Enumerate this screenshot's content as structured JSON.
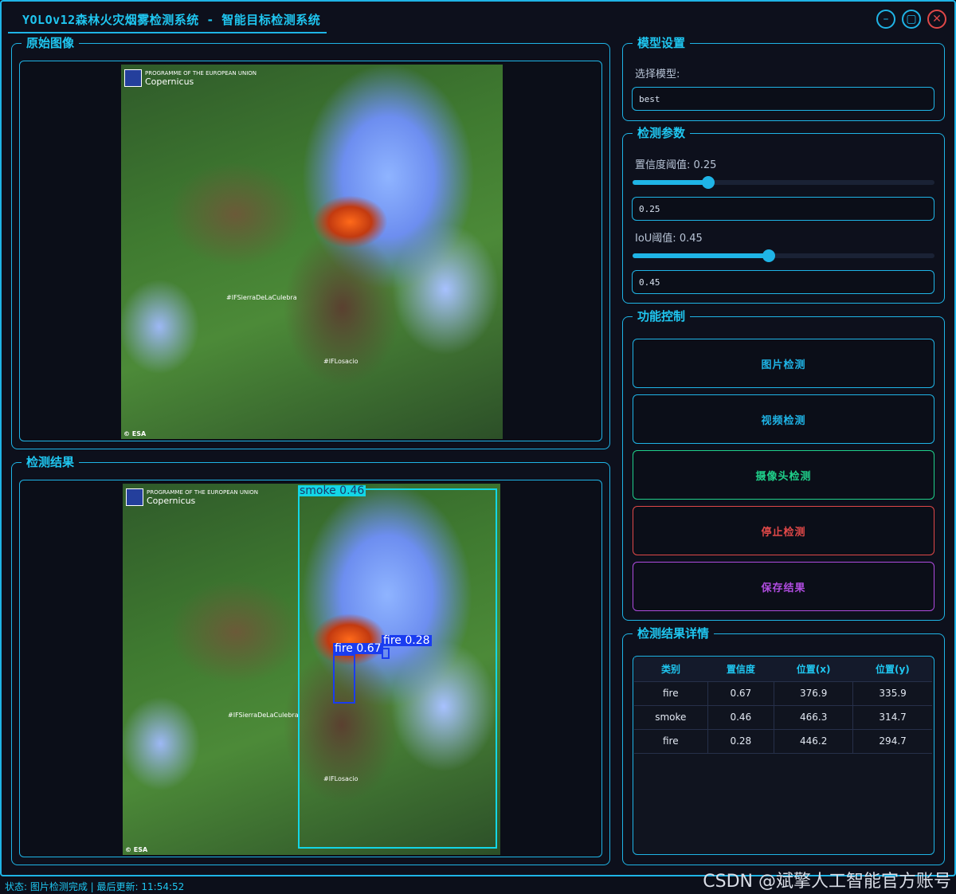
{
  "window": {
    "title": "YOLOv12森林火灾烟雾检测系统 - 智能目标检测系统",
    "min_icon": "minimize-icon",
    "max_icon": "maximize-icon",
    "close_icon": "close-icon"
  },
  "original_panel": {
    "title": "原始图像",
    "image": {
      "labels": [
        "#IFSierraDeLaCulebra",
        "#IFLosacio"
      ],
      "logo_text": "PROGRAMME OF THE EUROPEAN UNION",
      "brand": "Copernicus",
      "credit": "© ESA"
    }
  },
  "result_panel": {
    "title": "检测结果",
    "image": {
      "labels": [
        "#IFSierraDeLaCulebra",
        "#IFLosacio"
      ],
      "logo_text": "PROGRAMME OF THE EUROPEAN UNION",
      "brand": "Copernicus",
      "credit": "© ESA"
    },
    "detections": [
      {
        "label": "smoke 0.46",
        "color": "#13d6e6"
      },
      {
        "label": "fire 0.67",
        "color": "#1a3cf0"
      },
      {
        "label": "fire 0.28",
        "color": "#1a3cf0"
      }
    ]
  },
  "model_settings": {
    "title": "模型设置",
    "select_label": "选择模型:",
    "model_value": "best"
  },
  "detection_params": {
    "title": "检测参数",
    "conf_label": "置信度阈值: 0.25",
    "conf_value": 0.25,
    "conf_input": "0.25",
    "iou_label": "IoU阈值: 0.45",
    "iou_value": 0.45,
    "iou_input": "0.45"
  },
  "function_control": {
    "title": "功能控制",
    "buttons": [
      {
        "label": "图片检测",
        "color": "#1fb4e6"
      },
      {
        "label": "视频检测",
        "color": "#1fb4e6"
      },
      {
        "label": "摄像头检测",
        "color": "#1fd08a"
      },
      {
        "label": "停止检测",
        "color": "#e04848"
      },
      {
        "label": "保存结果",
        "color": "#b04ce0"
      }
    ]
  },
  "result_details": {
    "title": "检测结果详情",
    "columns": [
      "类别",
      "置信度",
      "位置(x)",
      "位置(y)"
    ],
    "rows": [
      [
        "fire",
        "0.67",
        "376.9",
        "335.9"
      ],
      [
        "smoke",
        "0.46",
        "466.3",
        "314.7"
      ],
      [
        "fire",
        "0.28",
        "446.2",
        "294.7"
      ]
    ]
  },
  "status": {
    "text": "状态: 图片检测完成 | 最后更新: 11:54:52"
  },
  "watermark": "CSDN @斌擎人工智能官方账号"
}
